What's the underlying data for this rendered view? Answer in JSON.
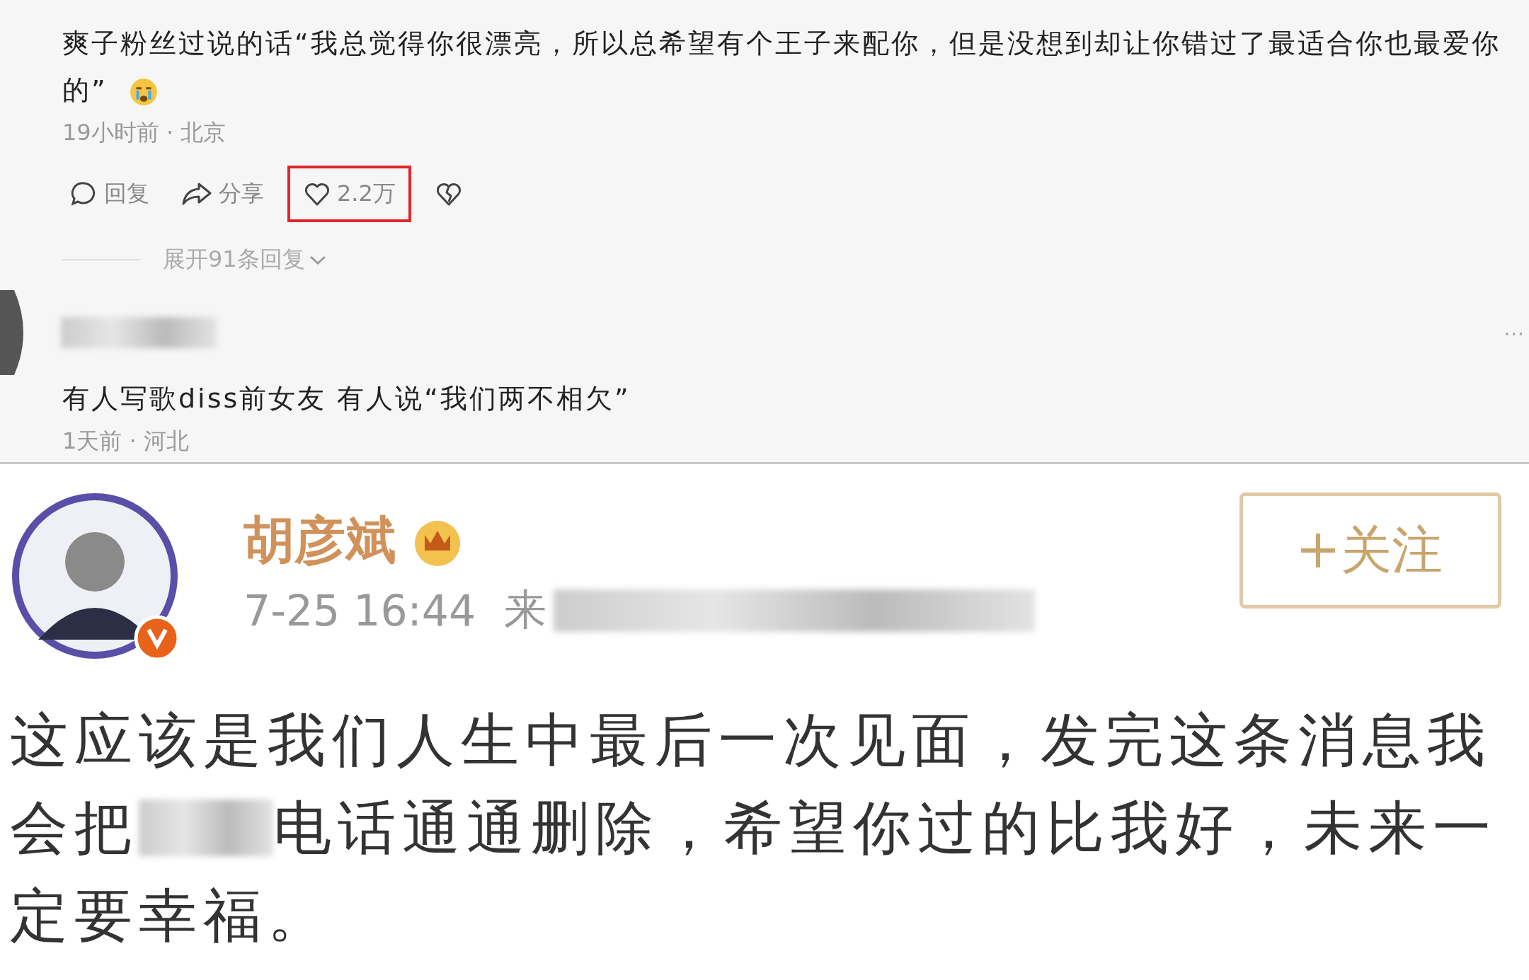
{
  "comments": [
    {
      "text": "爽子粉丝过说的话“我总觉得你很漂亮，所以总希望有个王子来配你，但是没想到却让你错过了最适合你也最爱你的”",
      "meta": "19小时前 · 北京",
      "redacted_name": false,
      "actions": [
        {
          "kind": "reply",
          "label": "回复",
          "highlighted": false
        },
        {
          "kind": "share",
          "label": "分享",
          "highlighted": false
        },
        {
          "kind": "like",
          "label": "2.2万",
          "highlighted": true
        },
        {
          "kind": "dislike",
          "highlighted": false
        }
      ],
      "expand": "展开91条回复"
    },
    {
      "text": "有人写歌diss前女友 有人说“我们两不相欠”",
      "meta": "1天前 · 河北",
      "redacted_name": true,
      "more": "⋯"
    }
  ],
  "post": {
    "name": "胡彦斌",
    "time": "7-25 16:44",
    "source": "来",
    "follow": "关注",
    "body": [
      "这应该是我们人生中最后一次见面，发完这条消息我",
      "会把",
      "电话通通删除，希望你过的比我好，未来一",
      "定要幸福。"
    ]
  }
}
